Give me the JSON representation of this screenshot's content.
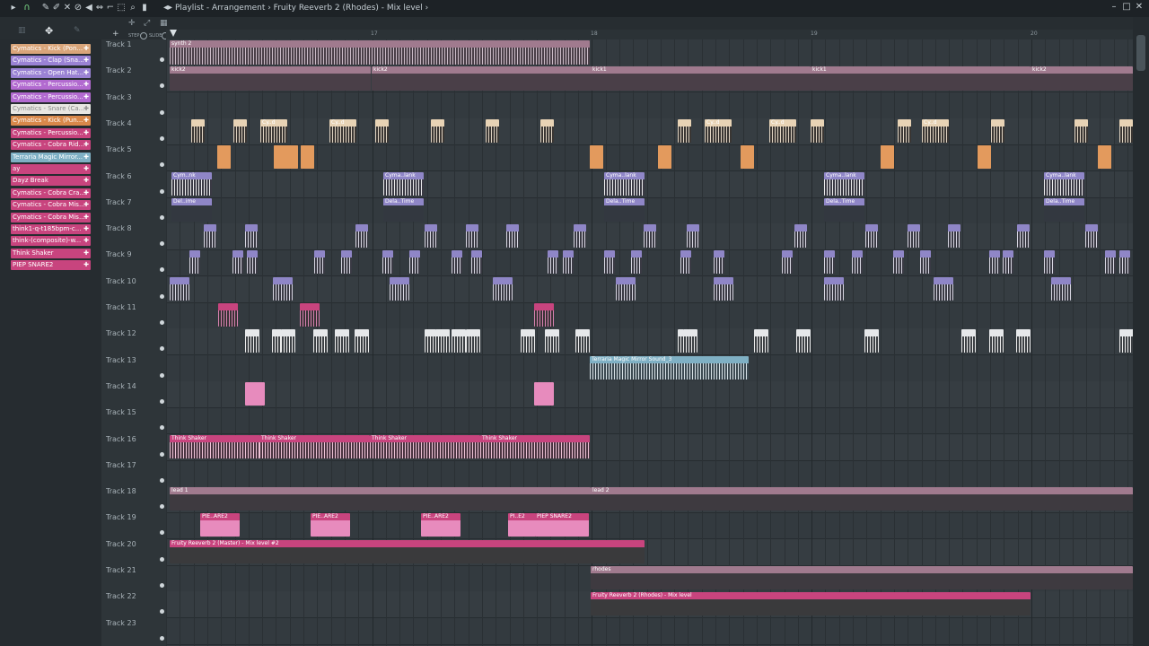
{
  "window": {
    "title": "Playlist - Arrangement › Fruity Reeverb 2 (Rhodes) - Mix level ›"
  },
  "ruler": {
    "bars": [
      "17",
      "18",
      "19",
      "20"
    ]
  },
  "picker": {
    "items": [
      {
        "label": "Cymatics - Kick (Pon...",
        "color": "#d9a57a"
      },
      {
        "label": "Cymatics - Clap (Sna...",
        "color": "#9a82d4"
      },
      {
        "label": "Cymatics - Open Hat...",
        "color": "#9a82d4"
      },
      {
        "label": "Cymatics - Percussio...",
        "color": "#b26ad0"
      },
      {
        "label": "Cymatics - Percussio...",
        "color": "#b26ad0"
      },
      {
        "label": "Cymatics - Snare (Ca...",
        "color": "#e8e6e2"
      },
      {
        "label": "Cymatics - Kick (Pun...",
        "color": "#d9884a"
      },
      {
        "label": "Cymatics - Percussio...",
        "color": "#c8447e"
      },
      {
        "label": "Cymatics - Cobra Rid...",
        "color": "#c8447e"
      },
      {
        "label": "Terraria Magic Mirror...",
        "color": "#7fb0c4"
      },
      {
        "label": "ay",
        "color": "#c8447e"
      },
      {
        "label": "Dayz Break",
        "color": "#c8447e"
      },
      {
        "label": "Cymatics - Cobra Cra...",
        "color": "#c8447e"
      },
      {
        "label": "Cymatics - Cobra Mis...",
        "color": "#c8447e"
      },
      {
        "label": "Cymatics - Cobra Mis...",
        "color": "#c8447e"
      },
      {
        "label": "think1-q-t185bpm-c...",
        "color": "#c8447e"
      },
      {
        "label": "think-(composite)-w...",
        "color": "#c8447e"
      },
      {
        "label": "Think Shaker",
        "color": "#c8447e"
      },
      {
        "label": "PIEP SNARE2",
        "color": "#c8447e"
      }
    ]
  },
  "tracks": [
    "Track 1",
    "Track 2",
    "Track 3",
    "Track 4",
    "Track 5",
    "Track 6",
    "Track 7",
    "Track 8",
    "Track 9",
    "Track 10",
    "Track 11",
    "Track 12",
    "Track 13",
    "Track 14",
    "Track 15",
    "Track 16",
    "Track 17",
    "Track 18",
    "Track 19",
    "Track 20",
    "Track 21",
    "Track 22",
    "Track 23"
  ],
  "clips": {
    "synth2": "synth 2",
    "kick2": "kick2",
    "kick1": "kick1",
    "cymnk": "Cym..nk",
    "cymalank": "Cyma..lank",
    "cymalank2": "Cyma..lank",
    "delime": "Del..ime",
    "delatime": "Dela..Time",
    "terraria": "Terraria Magic Mirror Sound_3",
    "thinkshaker": "Think Shaker",
    "lead1": "lead 1",
    "lead2": "lead 2",
    "piep": "PIE..ARE2",
    "piepsnare": "PIEP SNARE2",
    "piE2": "PI..E2",
    "reeverbmaster": "Fruity Reeverb 2 (Master) - Mix level #2",
    "rhodes": "rhodes",
    "reeverbrhodes": "Fruity Reeverb 2 (Rhodes) - Mix level",
    "cyd": "Cy..d"
  },
  "colors": {
    "pink": "#c8447e",
    "pinkLight": "#e78bbd",
    "lavender": "#8f86c7",
    "peach": "#e39a5d",
    "cream": "#e8d3b5",
    "mauve": "#a07a8e",
    "blue": "#7fb0c4",
    "white": "#e6e8ea"
  }
}
